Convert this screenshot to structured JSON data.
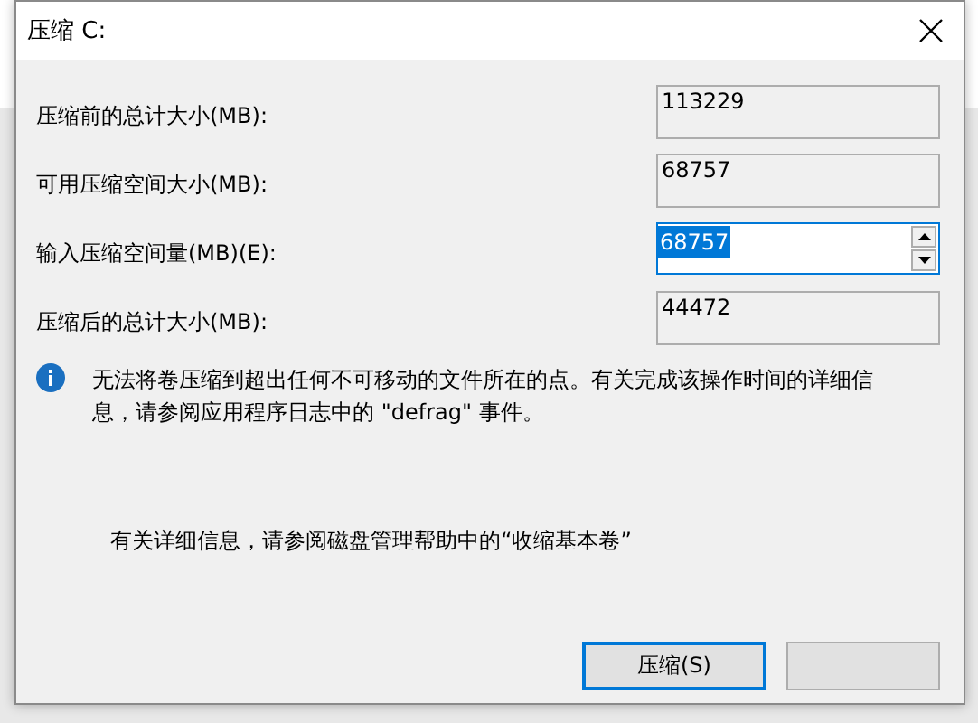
{
  "window": {
    "title": "压缩 C:"
  },
  "fields": [
    {
      "label": "压缩前的总计大小(MB):",
      "value": "113229",
      "kind": "readonly"
    },
    {
      "label": "可用压缩空间大小(MB):",
      "value": "68757",
      "kind": "readonly"
    },
    {
      "label": "输入压缩空间量(MB)(E):",
      "value": "68757",
      "kind": "spin",
      "selected": true
    },
    {
      "label": "压缩后的总计大小(MB):",
      "value": "44472",
      "kind": "readonly"
    }
  ],
  "info": "无法将卷压缩到超出任何不可移动的文件所在的点。有关完成该操作时间的详细信息，请参阅应用程序日志中的 \"defrag\" 事件。",
  "help": "有关详细信息，请参阅磁盘管理帮助中的“收缩基本卷”",
  "buttons": [
    {
      "label": "压缩(S)",
      "default": true
    },
    {
      "default": false
    }
  ]
}
